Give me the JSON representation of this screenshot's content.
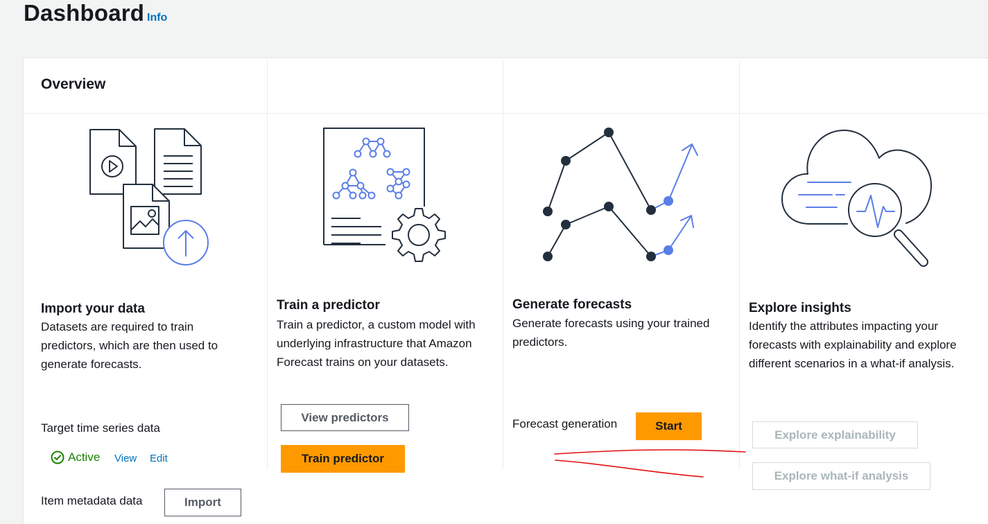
{
  "header": {
    "title": "Dashboard",
    "info_label": "Info"
  },
  "overview": {
    "title": "Overview"
  },
  "cards": {
    "import": {
      "title": "Import your data",
      "description": "Datasets are required to train predictors, which are then used to generate forecasts.",
      "target_label": "Target time series data",
      "status_text": "Active",
      "view_label": "View",
      "edit_label": "Edit",
      "item_metadata_label": "Item metadata data",
      "import_button": "Import"
    },
    "train": {
      "title": "Train a predictor",
      "description": "Train a predictor, a custom model with underlying infrastructure that Amazon Forecast trains on your datasets.",
      "view_button": "View predictors",
      "train_button": "Train predictor"
    },
    "generate": {
      "title": "Generate forecasts",
      "description": "Generate forecasts using your trained predictors.",
      "generation_label": "Forecast generation",
      "start_button": "Start"
    },
    "explore": {
      "title": "Explore insights",
      "description": "Identify the attributes impacting your forecasts with explainability and explore different scenarios in a what-if analysis.",
      "explainability_button": "Explore explainability",
      "whatif_button": "Explore what-if analysis"
    }
  },
  "colors": {
    "brand_orange": "#ff9900",
    "link_blue": "#0073bb",
    "illustration_blue": "#5a7ee8",
    "success_green": "#1d8102",
    "annotation_red": "#e01010"
  },
  "icons": [
    "documents-upload-illustration",
    "predictor-document-gear-illustration",
    "forecast-lines-illustration",
    "cloud-insights-illustration",
    "check-circle-icon"
  ]
}
